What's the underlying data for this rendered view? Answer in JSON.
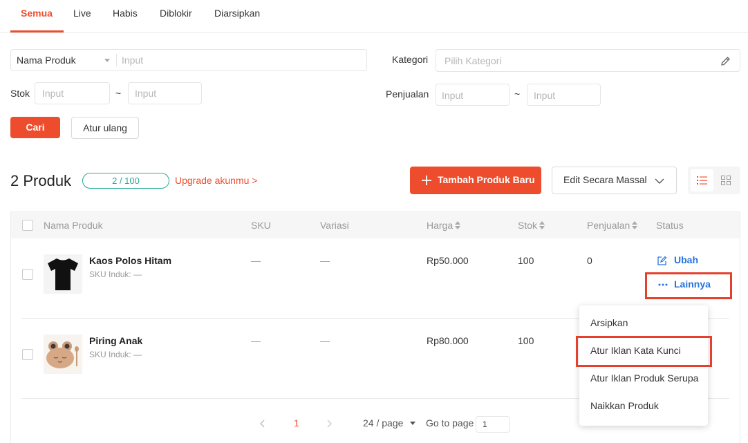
{
  "tabs": [
    {
      "label": "Semua"
    },
    {
      "label": "Live"
    },
    {
      "label": "Habis"
    },
    {
      "label": "Diblokir"
    },
    {
      "label": "Diarsipkan"
    }
  ],
  "filters": {
    "search_type": "Nama Produk",
    "search_placeholder": "Input",
    "kategori_label": "Kategori",
    "kategori_placeholder": "Pilih Kategori",
    "stok_label": "Stok",
    "stok_min_placeholder": "Input",
    "stok_max_placeholder": "Input",
    "penjualan_label": "Penjualan",
    "penjualan_min_placeholder": "Input",
    "penjualan_max_placeholder": "Input",
    "range_sep": "~",
    "search_button": "Cari",
    "reset_button": "Atur ulang"
  },
  "summary": {
    "count_text": "2 Produk",
    "quota": "2 / 100",
    "upgrade_link": "Upgrade akunmu >",
    "add_button": "Tambah Produk Baru",
    "bulk_edit": "Edit Secara Massal"
  },
  "table": {
    "headers": [
      "Nama Produk",
      "SKU",
      "Variasi",
      "Harga",
      "Stok",
      "Penjualan",
      "Status"
    ],
    "rows": [
      {
        "name": "Kaos Polos Hitam",
        "sku_parent": "SKU Induk: —",
        "sku": "—",
        "variasi": "—",
        "harga": "Rp50.000",
        "stok": "100",
        "penjualan": "0"
      },
      {
        "name": "Piring Anak",
        "sku_parent": "SKU Induk: —",
        "sku": "—",
        "variasi": "—",
        "harga": "Rp80.000",
        "stok": "100",
        "penjualan": ""
      }
    ],
    "actions": {
      "edit": "Ubah",
      "more": "Lainnya"
    }
  },
  "more_menu": {
    "items": [
      "Arsipkan",
      "Atur Iklan Kata Kunci",
      "Atur Iklan Produk Serupa",
      "Naikkan Produk"
    ]
  },
  "pagination": {
    "current_page": "1",
    "page_size": "24 / page",
    "goto_label": "Go to page",
    "goto_value": "1"
  },
  "colors": {
    "accent": "#ee4d2d",
    "link": "#2673dd",
    "quota": "#26aa99",
    "highlight": "#e4402b"
  }
}
